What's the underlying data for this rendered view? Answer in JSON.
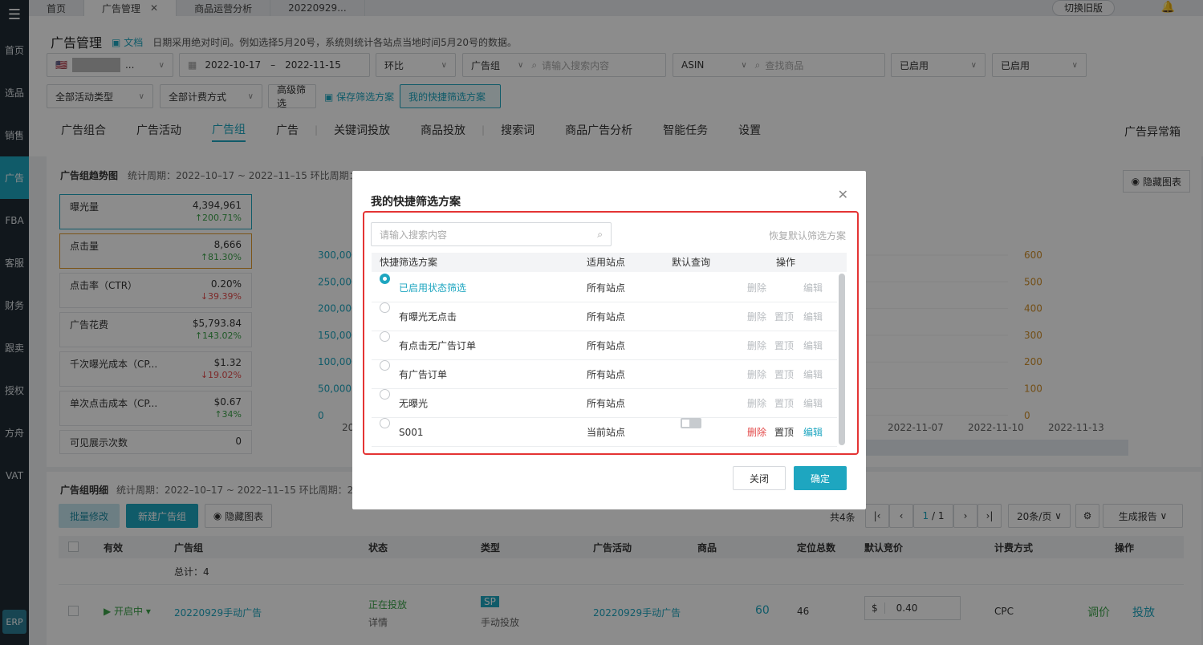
{
  "sidebar": {
    "items": [
      "首页",
      "选品",
      "销售",
      "广告",
      "FBA",
      "客服",
      "财务",
      "跟卖",
      "授权",
      "方舟",
      "VAT"
    ],
    "erp": "ERP"
  },
  "tabs": [
    "首页",
    "广告管理",
    "商品运营分析",
    "20220929..."
  ],
  "topbar": {
    "old_btn": "切换旧版"
  },
  "page": {
    "title": "广告管理",
    "doc": "文档",
    "note": "日期采用绝对时间。例如选择5月20号，系统则统计各站点当地时间5月20号的数据。"
  },
  "filters": {
    "date_start": "2022-10-17",
    "date_sep": "–",
    "date_end": "2022-11-15",
    "compare": "环比",
    "group_label": "广告组",
    "group_ph": "请输入搜索内容",
    "asin": "ASIN",
    "product_ph": "查找商品",
    "status1": "已启用",
    "status2": "已启用",
    "activity_type": "全部活动类型",
    "billing": "全部计费方式",
    "advanced": "高级筛选",
    "save": "保存筛选方案",
    "mine": "我的快捷筛选方案"
  },
  "main_tabs": [
    "广告组合",
    "广告活动",
    "广告组",
    "广告",
    "关键词投放",
    "商品投放",
    "搜索词",
    "商品广告分析",
    "智能任务",
    "设置"
  ],
  "anomaly": "广告异常箱",
  "trend": {
    "title": "广告组趋势图",
    "period": "统计周期：2022–10–17 ~ 2022–11–15 环比周期：",
    "hide": "隐藏图表"
  },
  "metrics": [
    {
      "name": "曝光量",
      "value": "4,394,961",
      "delta": "↑200.71%",
      "dir": "up"
    },
    {
      "name": "点击量",
      "value": "8,666",
      "delta": "↑81.30%",
      "dir": "up"
    },
    {
      "name": "点击率（CTR）",
      "value": "0.20%",
      "delta": "↓39.39%",
      "dir": "down"
    },
    {
      "name": "广告花费",
      "value": "$5,793.84",
      "delta": "↑143.02%",
      "dir": "up"
    },
    {
      "name": "千次曝光成本（CP...",
      "value": "$1.32",
      "delta": "↓19.02%",
      "dir": "down"
    },
    {
      "name": "单次点击成本（CP...",
      "value": "$0.67",
      "delta": "↑34%",
      "dir": "up"
    },
    {
      "name": "可见展示次数",
      "value": "0",
      "delta": "",
      "dir": "up"
    }
  ],
  "chart_data": {
    "type": "line",
    "left_ticks": [
      "300,000",
      "250,000",
      "200,000",
      "150,000",
      "100,000",
      "50,000",
      "0"
    ],
    "right_ticks": [
      "600",
      "500",
      "400",
      "300",
      "200",
      "100",
      "0"
    ],
    "x_labels": [
      "2022-10",
      "2022-11-07",
      "2022-11-10",
      "2022-11-13"
    ]
  },
  "detail": {
    "title": "广告组明细",
    "period": "统计周期：2022–10–17 ~ 2022–11–15 环比周期：20",
    "batch": "批量修改",
    "new": "新建广告组",
    "hide": "隐藏图表",
    "total": "共4条",
    "page": "1",
    "pages": "/ 1",
    "per_page": "20条/页",
    "report": "生成报告"
  },
  "table": {
    "headers": [
      "有效",
      "广告组",
      "状态",
      "类型",
      "广告活动",
      "商品",
      "定位总数",
      "默认竞价",
      "计费方式",
      "操作"
    ],
    "total_row": "总计：4",
    "row": {
      "valid": "开启中",
      "group": "20220929手动广告",
      "status": "正在投放",
      "status_sub": "详情",
      "type": "SP",
      "type_sub": "手动投放",
      "campaign": "20220929手动广告",
      "products": "60",
      "targets": "46",
      "bid_prefix": "$",
      "bid": "0.40",
      "billing": "CPC",
      "op1": "调价",
      "op2": "投放"
    }
  },
  "modal": {
    "title": "我的快捷筛选方案",
    "search_ph": "请输入搜索内容",
    "restore": "恢复默认筛选方案",
    "headers": [
      "快捷筛选方案",
      "适用站点",
      "默认查询",
      "操作"
    ],
    "rows": [
      {
        "name": "已启用状态筛选",
        "site": "所有站点",
        "selected": true,
        "ops": [
          "删除",
          "编辑"
        ]
      },
      {
        "name": "有曝光无点击",
        "site": "所有站点",
        "selected": false,
        "ops": [
          "删除",
          "置顶",
          "编辑"
        ]
      },
      {
        "name": "有点击无广告订单",
        "site": "所有站点",
        "selected": false,
        "ops": [
          "删除",
          "置顶",
          "编辑"
        ]
      },
      {
        "name": "有广告订单",
        "site": "所有站点",
        "selected": false,
        "ops": [
          "删除",
          "置顶",
          "编辑"
        ]
      },
      {
        "name": "无曝光",
        "site": "所有站点",
        "selected": false,
        "ops": [
          "删除",
          "置顶",
          "编辑"
        ]
      },
      {
        "name": "S001",
        "site": "当前站点",
        "selected": false,
        "ops": [
          "删除",
          "置顶",
          "编辑"
        ]
      }
    ],
    "close": "关闭",
    "ok": "确定"
  }
}
